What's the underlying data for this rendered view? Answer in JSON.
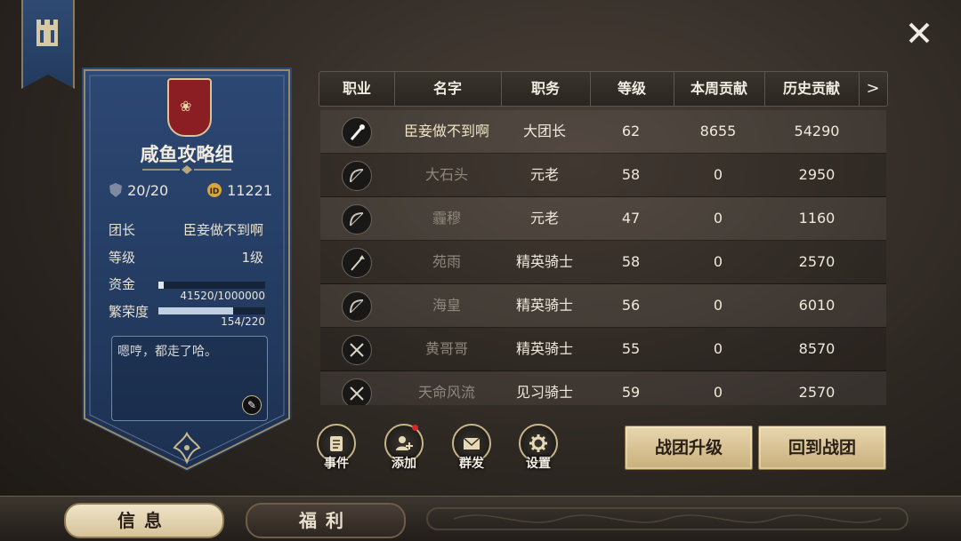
{
  "guild": {
    "name": "咸鱼攻略组",
    "emblem_icon": "rose-shield-icon",
    "members_count": "20/20",
    "funds_id_value": "11221",
    "leader_label": "团长",
    "leader_value": "臣妾做不到啊",
    "level_label": "等级",
    "level_value": "1级",
    "funds_label": "资金",
    "funds_text": "41520/1000000",
    "funds_fraction": 0.0415,
    "prosperity_label": "繁荣度",
    "prosperity_text": "154/220",
    "prosperity_fraction": 0.7,
    "notice": "嗯哼，都走了哈。"
  },
  "table": {
    "headers": [
      "职业",
      "名字",
      "职务",
      "等级",
      "本周贡献",
      "历史贡献"
    ],
    "more_arrow": ">",
    "rows": [
      {
        "class_icon": "dagger-icon",
        "name": "臣妾做不到啊",
        "role": "大团长",
        "level": "62",
        "weekly": "8655",
        "history": "54290",
        "active": true
      },
      {
        "class_icon": "bow-icon",
        "name": "大石头",
        "role": "元老",
        "level": "58",
        "weekly": "0",
        "history": "2950",
        "active": false
      },
      {
        "class_icon": "bow-icon",
        "name": "霾穆",
        "role": "元老",
        "level": "47",
        "weekly": "0",
        "history": "1160",
        "active": false
      },
      {
        "class_icon": "spear-icon",
        "name": "苑雨",
        "role": "精英骑士",
        "level": "58",
        "weekly": "0",
        "history": "2570",
        "active": false
      },
      {
        "class_icon": "bow-icon",
        "name": "海皇",
        "role": "精英骑士",
        "level": "56",
        "weekly": "0",
        "history": "6010",
        "active": false
      },
      {
        "class_icon": "crossed-swords-icon",
        "name": "黄哥哥",
        "role": "精英骑士",
        "level": "55",
        "weekly": "0",
        "history": "8570",
        "active": false
      },
      {
        "class_icon": "crossed-swords-icon",
        "name": "天命风流",
        "role": "见习骑士",
        "level": "59",
        "weekly": "0",
        "history": "2570",
        "active": false
      }
    ]
  },
  "actions": {
    "events": "事件",
    "add": "添加",
    "mass_message": "群发",
    "settings": "设置"
  },
  "buttons": {
    "upgrade": "战团升级",
    "return": "回到战团"
  },
  "tabs": {
    "info": "信息",
    "welfare": "福利"
  }
}
